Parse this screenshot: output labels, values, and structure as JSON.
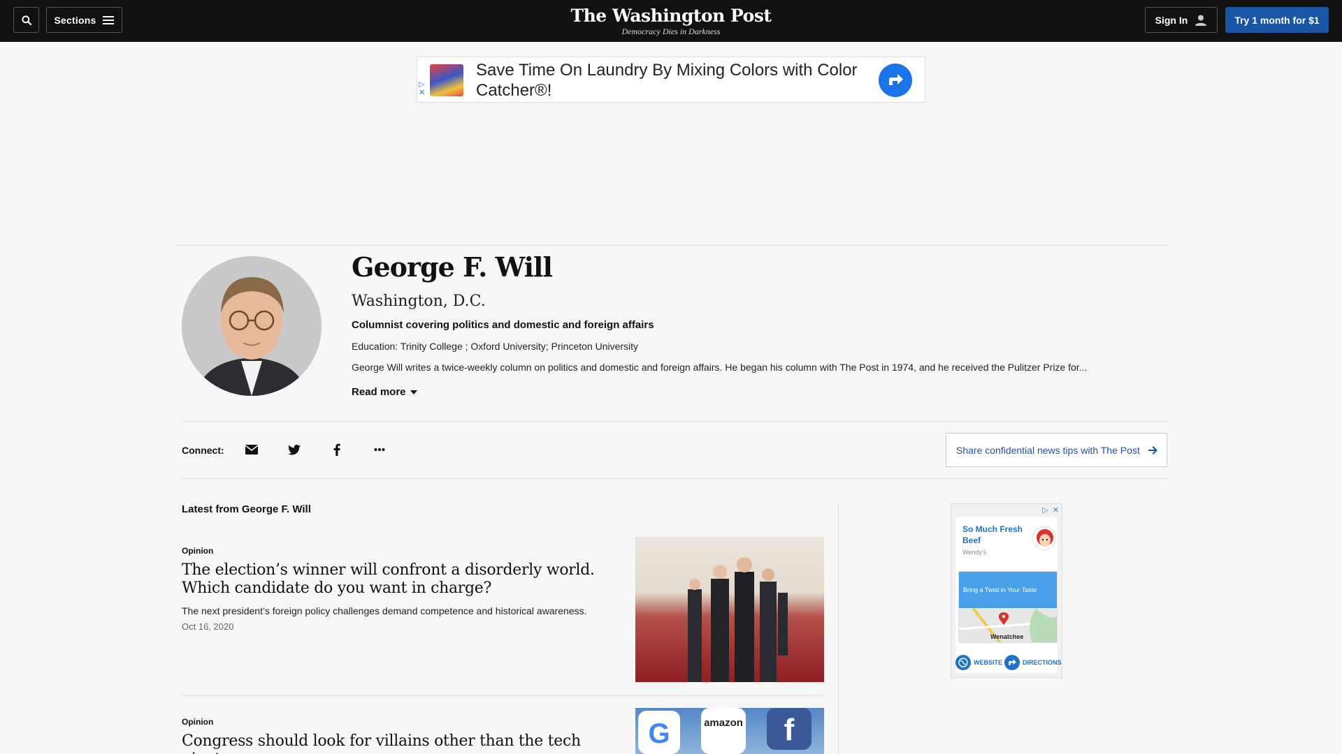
{
  "nav": {
    "sections_label": "Sections",
    "signin_label": "Sign In",
    "subscribe_label": "Try 1 month for $1",
    "logo_text": "The Washington Post",
    "tagline": "Democracy Dies in Darkness"
  },
  "top_ad": {
    "headline": "Save Time On Laundry By Mixing Colors with Color Catcher®!"
  },
  "author": {
    "name": "George F. Will",
    "location": "Washington, D.C.",
    "role": "Columnist covering politics and domestic and foreign affairs",
    "education": "Education: Trinity College ; Oxford University; Princeton University",
    "bio": "George Will writes a twice-weekly column on politics and domestic and foreign affairs. He began his column with The Post in 1974, and he received the Pulitzer Prize for...",
    "read_more_label": "Read more"
  },
  "connect": {
    "label": "Connect:",
    "icons": [
      "email-icon",
      "twitter-icon",
      "facebook-icon",
      "more-icon"
    ],
    "tips_label": "Share confidential news tips with The Post"
  },
  "latest": {
    "heading": "Latest from George F. Will",
    "articles": [
      {
        "kicker": "Opinion",
        "headline": "The election’s winner will confront a disorderly world. Which candidate do you want in charge?",
        "blurb": "The next president’s foreign policy challenges demand competence and historical awareness.",
        "date": "Oct 16, 2020"
      },
      {
        "kicker": "Opinion",
        "headline": "Congress should look for villains other than the tech giants"
      }
    ]
  },
  "side_ad": {
    "title": "So Much Fresh Beef",
    "brand": "Wendy's",
    "banner_text": "Bring a Twist in Your Taste",
    "map_city": "Wenatchee",
    "website_label": "WEBSITE",
    "directions_label": "DIRECTIONS"
  },
  "colors": {
    "topbar": "#111111",
    "accent_blue": "#1955a5",
    "link_blue": "#1f72c6",
    "page_bg": "#f7f7f7"
  }
}
